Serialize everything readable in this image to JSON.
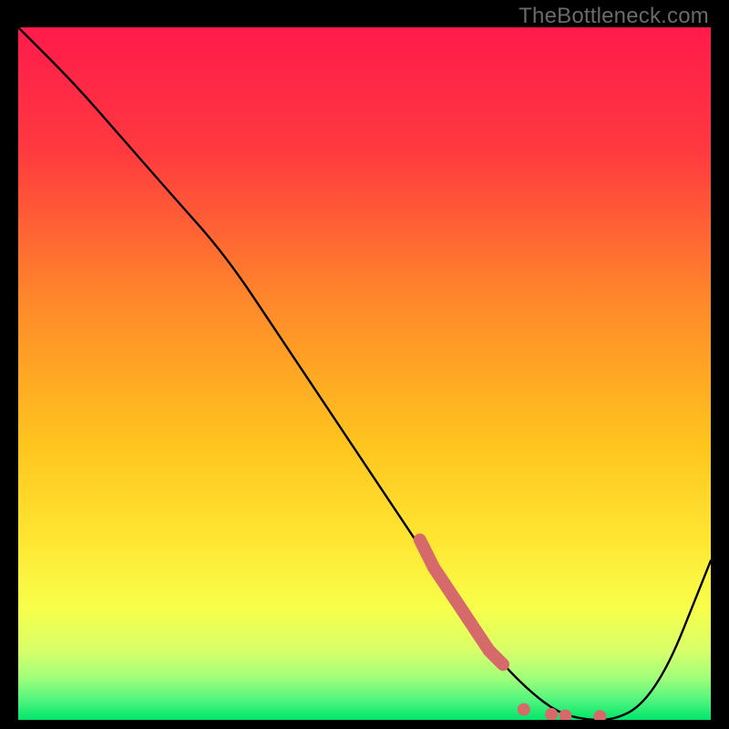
{
  "watermark": "TheBottleneck.com",
  "colors": {
    "gradient_top": "#ff1a4b",
    "gradient_mid": "#ffd400",
    "gradient_bottom": "#00e66b",
    "curve": "#000000",
    "dots": "#d66a6a",
    "background": "#000000"
  },
  "chart_data": {
    "type": "line",
    "title": "",
    "xlabel": "",
    "ylabel": "",
    "xlim": [
      0,
      100
    ],
    "ylim": [
      0,
      100
    ],
    "series": [
      {
        "name": "bottleneck-curve",
        "x": [
          0,
          8,
          15,
          22,
          30,
          38,
          46,
          54,
          60,
          66,
          70,
          74,
          78,
          82,
          86,
          90,
          94,
          98,
          100
        ],
        "y": [
          100,
          92,
          84,
          76,
          67,
          55,
          43,
          31,
          22,
          13,
          8,
          4,
          1,
          0,
          0,
          2,
          8,
          18,
          23
        ]
      }
    ],
    "highlight_segment": {
      "name": "thick-pink-segment",
      "x": [
        58,
        60,
        62,
        64,
        66,
        68,
        70
      ],
      "y": [
        26,
        22,
        19,
        16,
        13,
        10,
        8
      ]
    },
    "highlight_dots": {
      "name": "baseline-dots",
      "points": [
        {
          "x": 73,
          "y": 1.5
        },
        {
          "x": 77,
          "y": 0.8
        },
        {
          "x": 79,
          "y": 0.6
        },
        {
          "x": 84,
          "y": 0.5
        }
      ]
    }
  }
}
